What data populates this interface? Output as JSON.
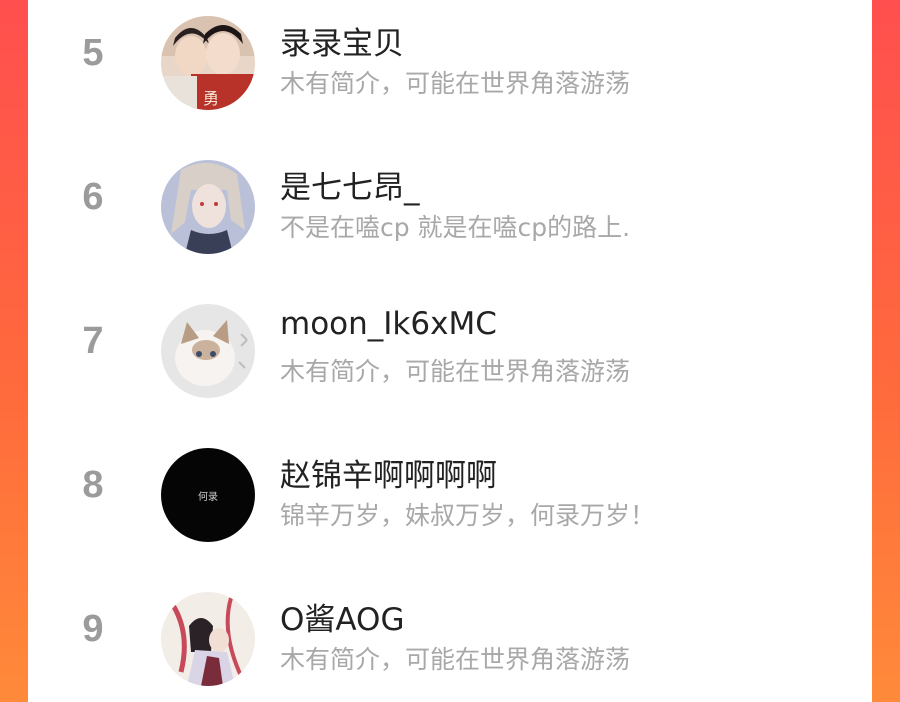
{
  "ranking": {
    "items": [
      {
        "rank": "5",
        "name": "录录宝贝",
        "bio": "木有简介，可能在世界角落游荡"
      },
      {
        "rank": "6",
        "name": "是七七昂_",
        "bio": "不是在嗑cp 就是在嗑cp的路上."
      },
      {
        "rank": "7",
        "name": "moon_Ik6xMC",
        "bio": "木有简介，可能在世界角落游荡"
      },
      {
        "rank": "8",
        "name": "赵锦辛啊啊啊啊",
        "bio": "锦辛万岁，妹叔万岁，何录万岁！",
        "avatar_text": "何录"
      },
      {
        "rank": "9",
        "name": "O酱AOG",
        "bio": "木有简介，可能在世界角落游荡"
      }
    ]
  },
  "colors": {
    "background_gradient": [
      "#ff4f4f",
      "#ff8a3a"
    ],
    "card": "#ffffff",
    "rank_text": "#9b9b9b",
    "name_text": "#222222",
    "bio_text": "#a8a8a8"
  }
}
